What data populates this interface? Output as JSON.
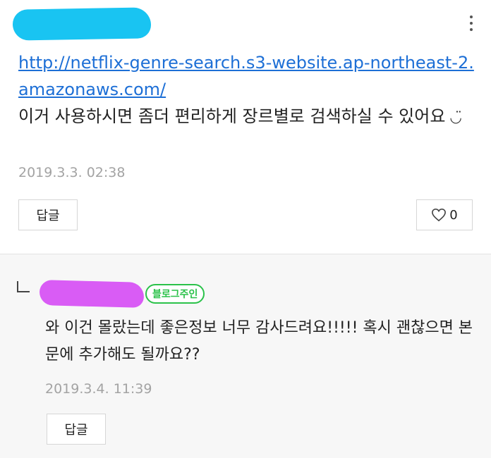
{
  "comment": {
    "link": "http://netflix-genre-search.s3-website.ap-northeast-2.amazonaws.com/",
    "text": "이거 사용하시면 좀더 편리하게 장르별로 검색하실 수 있어요",
    "emoticon": "◡̈",
    "date": "2019.3.3. 02:38",
    "reply_label": "답글",
    "like_count": "0",
    "icons": {
      "more": "more-vertical-icon",
      "like": "heart-icon"
    }
  },
  "reply": {
    "owner_badge": "블로그주인",
    "text": "와 이건 몰랐는데 좋은정보 너무 감사드려요!!!!! 혹시 괜찮으면 본문에 추가해도 될까요??",
    "date": "2019.3.4. 11:39",
    "reply_label": "답글",
    "icons": {
      "reply_indicator": "reply-arrow-icon"
    }
  },
  "colors": {
    "link": "#1d6fd6",
    "badge": "#2bc24a",
    "redaction_author": "#19c4f2",
    "redaction_owner": "#d95cf5",
    "reply_background": "#f7f7f7"
  }
}
